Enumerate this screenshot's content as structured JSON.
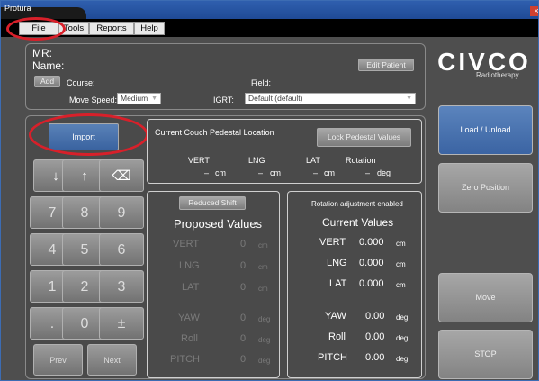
{
  "window": {
    "title": "Protura",
    "close_glyph": "×",
    "min_glyph": "_"
  },
  "menu": [
    {
      "label": "File"
    },
    {
      "label": "Tools"
    },
    {
      "label": "Reports"
    },
    {
      "label": "Help"
    }
  ],
  "patient": {
    "mr_label": "MR:",
    "name_label": "Name:",
    "edit_button": "Edit Patient",
    "add_button": "Add",
    "course_label": "Course:",
    "field_label": "Field:",
    "move_speed_label": "Move Speed:",
    "move_speed_value": "Medium",
    "igrt_label": "IGRT:",
    "igrt_value": "Default (default)"
  },
  "brand": {
    "logo": "CIVCO",
    "sub": "Radiotherapy"
  },
  "keypad": {
    "import_label": "Import",
    "arrow_down": "↓",
    "arrow_up": "↑",
    "backspace": "⌫",
    "keys": [
      "7",
      "8",
      "9",
      "4",
      "5",
      "6",
      "1",
      "2",
      "3",
      ".",
      "0",
      "±"
    ],
    "prev_label": "Prev",
    "next_label": "Next"
  },
  "current_location": {
    "title": "Current Couch Pedestal Location",
    "lock_button": "Lock Pedestal Values",
    "headers": [
      "VERT",
      "LNG",
      "LAT",
      "Rotation"
    ],
    "values": [
      "–",
      "–",
      "–",
      "–"
    ],
    "units": [
      "cm",
      "cm",
      "cm",
      "deg"
    ]
  },
  "proposed": {
    "reduced_shift_button": "Reduced Shift",
    "title": "Proposed Values",
    "rows": [
      {
        "label": "VERT",
        "value": "0",
        "unit": "cm"
      },
      {
        "label": "LNG",
        "value": "0",
        "unit": "cm"
      },
      {
        "label": "LAT",
        "value": "0",
        "unit": "cm"
      },
      {
        "label": "YAW",
        "value": "0",
        "unit": "deg"
      },
      {
        "label": "Roll",
        "value": "0",
        "unit": "deg"
      },
      {
        "label": "PITCH",
        "value": "0",
        "unit": "deg"
      }
    ]
  },
  "current_values": {
    "rotation_note": "Rotation adjustment enabled",
    "title": "Current Values",
    "rows": [
      {
        "label": "VERT",
        "value": "0.000",
        "unit": "cm"
      },
      {
        "label": "LNG",
        "value": "0.000",
        "unit": "cm"
      },
      {
        "label": "LAT",
        "value": "0.000",
        "unit": "cm"
      },
      {
        "label": "YAW",
        "value": "0.00",
        "unit": "deg"
      },
      {
        "label": "Roll",
        "value": "0.00",
        "unit": "deg"
      },
      {
        "label": "PITCH",
        "value": "0.00",
        "unit": "deg"
      }
    ]
  },
  "side_buttons": {
    "load": "Load / Unload",
    "zero": "Zero Position",
    "move": "Move",
    "stop": "STOP"
  },
  "colors": {
    "accent_blue": "#4a72a8",
    "annotation_red": "#d8202a"
  }
}
